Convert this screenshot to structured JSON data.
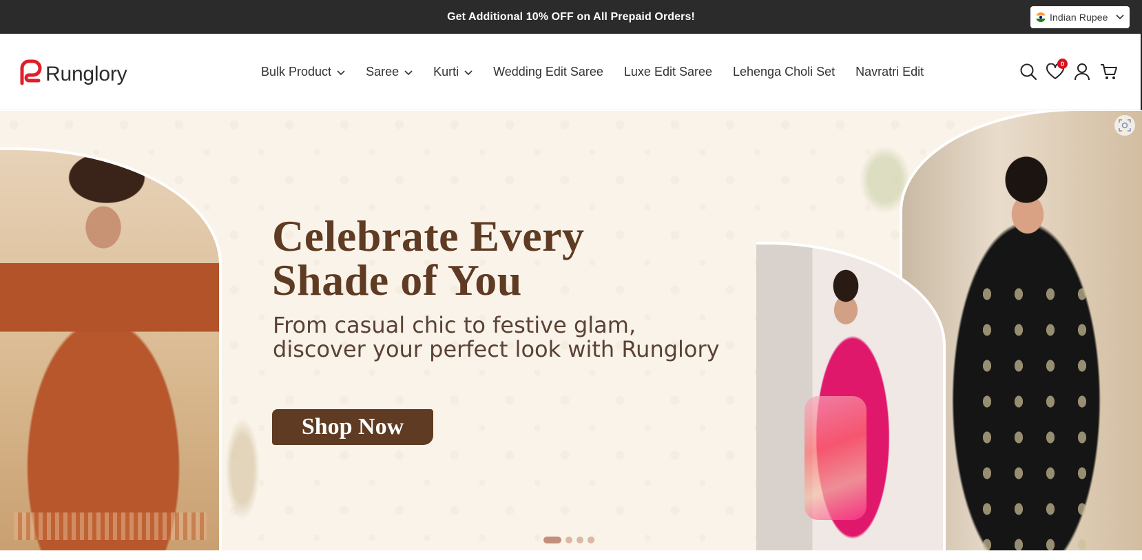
{
  "announcement": {
    "text": "Get Additional 10% OFF on All Prepaid Orders!"
  },
  "currency": {
    "selected": "Indian Rupee",
    "flag_icon": "india-flag-icon"
  },
  "header": {
    "logo_text": "Runglory",
    "brand_color": "#e01e2b",
    "nav": [
      {
        "label": "Bulk Product",
        "has_dropdown": true
      },
      {
        "label": "Saree",
        "has_dropdown": true
      },
      {
        "label": "Kurti",
        "has_dropdown": true
      },
      {
        "label": "Wedding Edit Saree",
        "has_dropdown": false
      },
      {
        "label": "Luxe Edit Saree",
        "has_dropdown": false
      },
      {
        "label": "Lehenga Choli Set",
        "has_dropdown": false
      },
      {
        "label": "Navratri Edit",
        "has_dropdown": false
      }
    ],
    "icons": [
      "search-icon",
      "wishlist-icon",
      "account-icon",
      "cart-icon"
    ],
    "wishlist_count": "0"
  },
  "hero": {
    "title_line1": "Celebrate Every",
    "title_line2": "Shade of You",
    "subtitle_line1": "From casual chic to festive glam,",
    "subtitle_line2": "discover your perfect look with Runglory",
    "cta_label": "Shop Now",
    "accent_color": "#5e3b22",
    "slides_total": 4,
    "slide_active": 1
  },
  "colors": {
    "announcement_bg": "#2b2b2b",
    "hero_bg": "#faf3ea"
  }
}
